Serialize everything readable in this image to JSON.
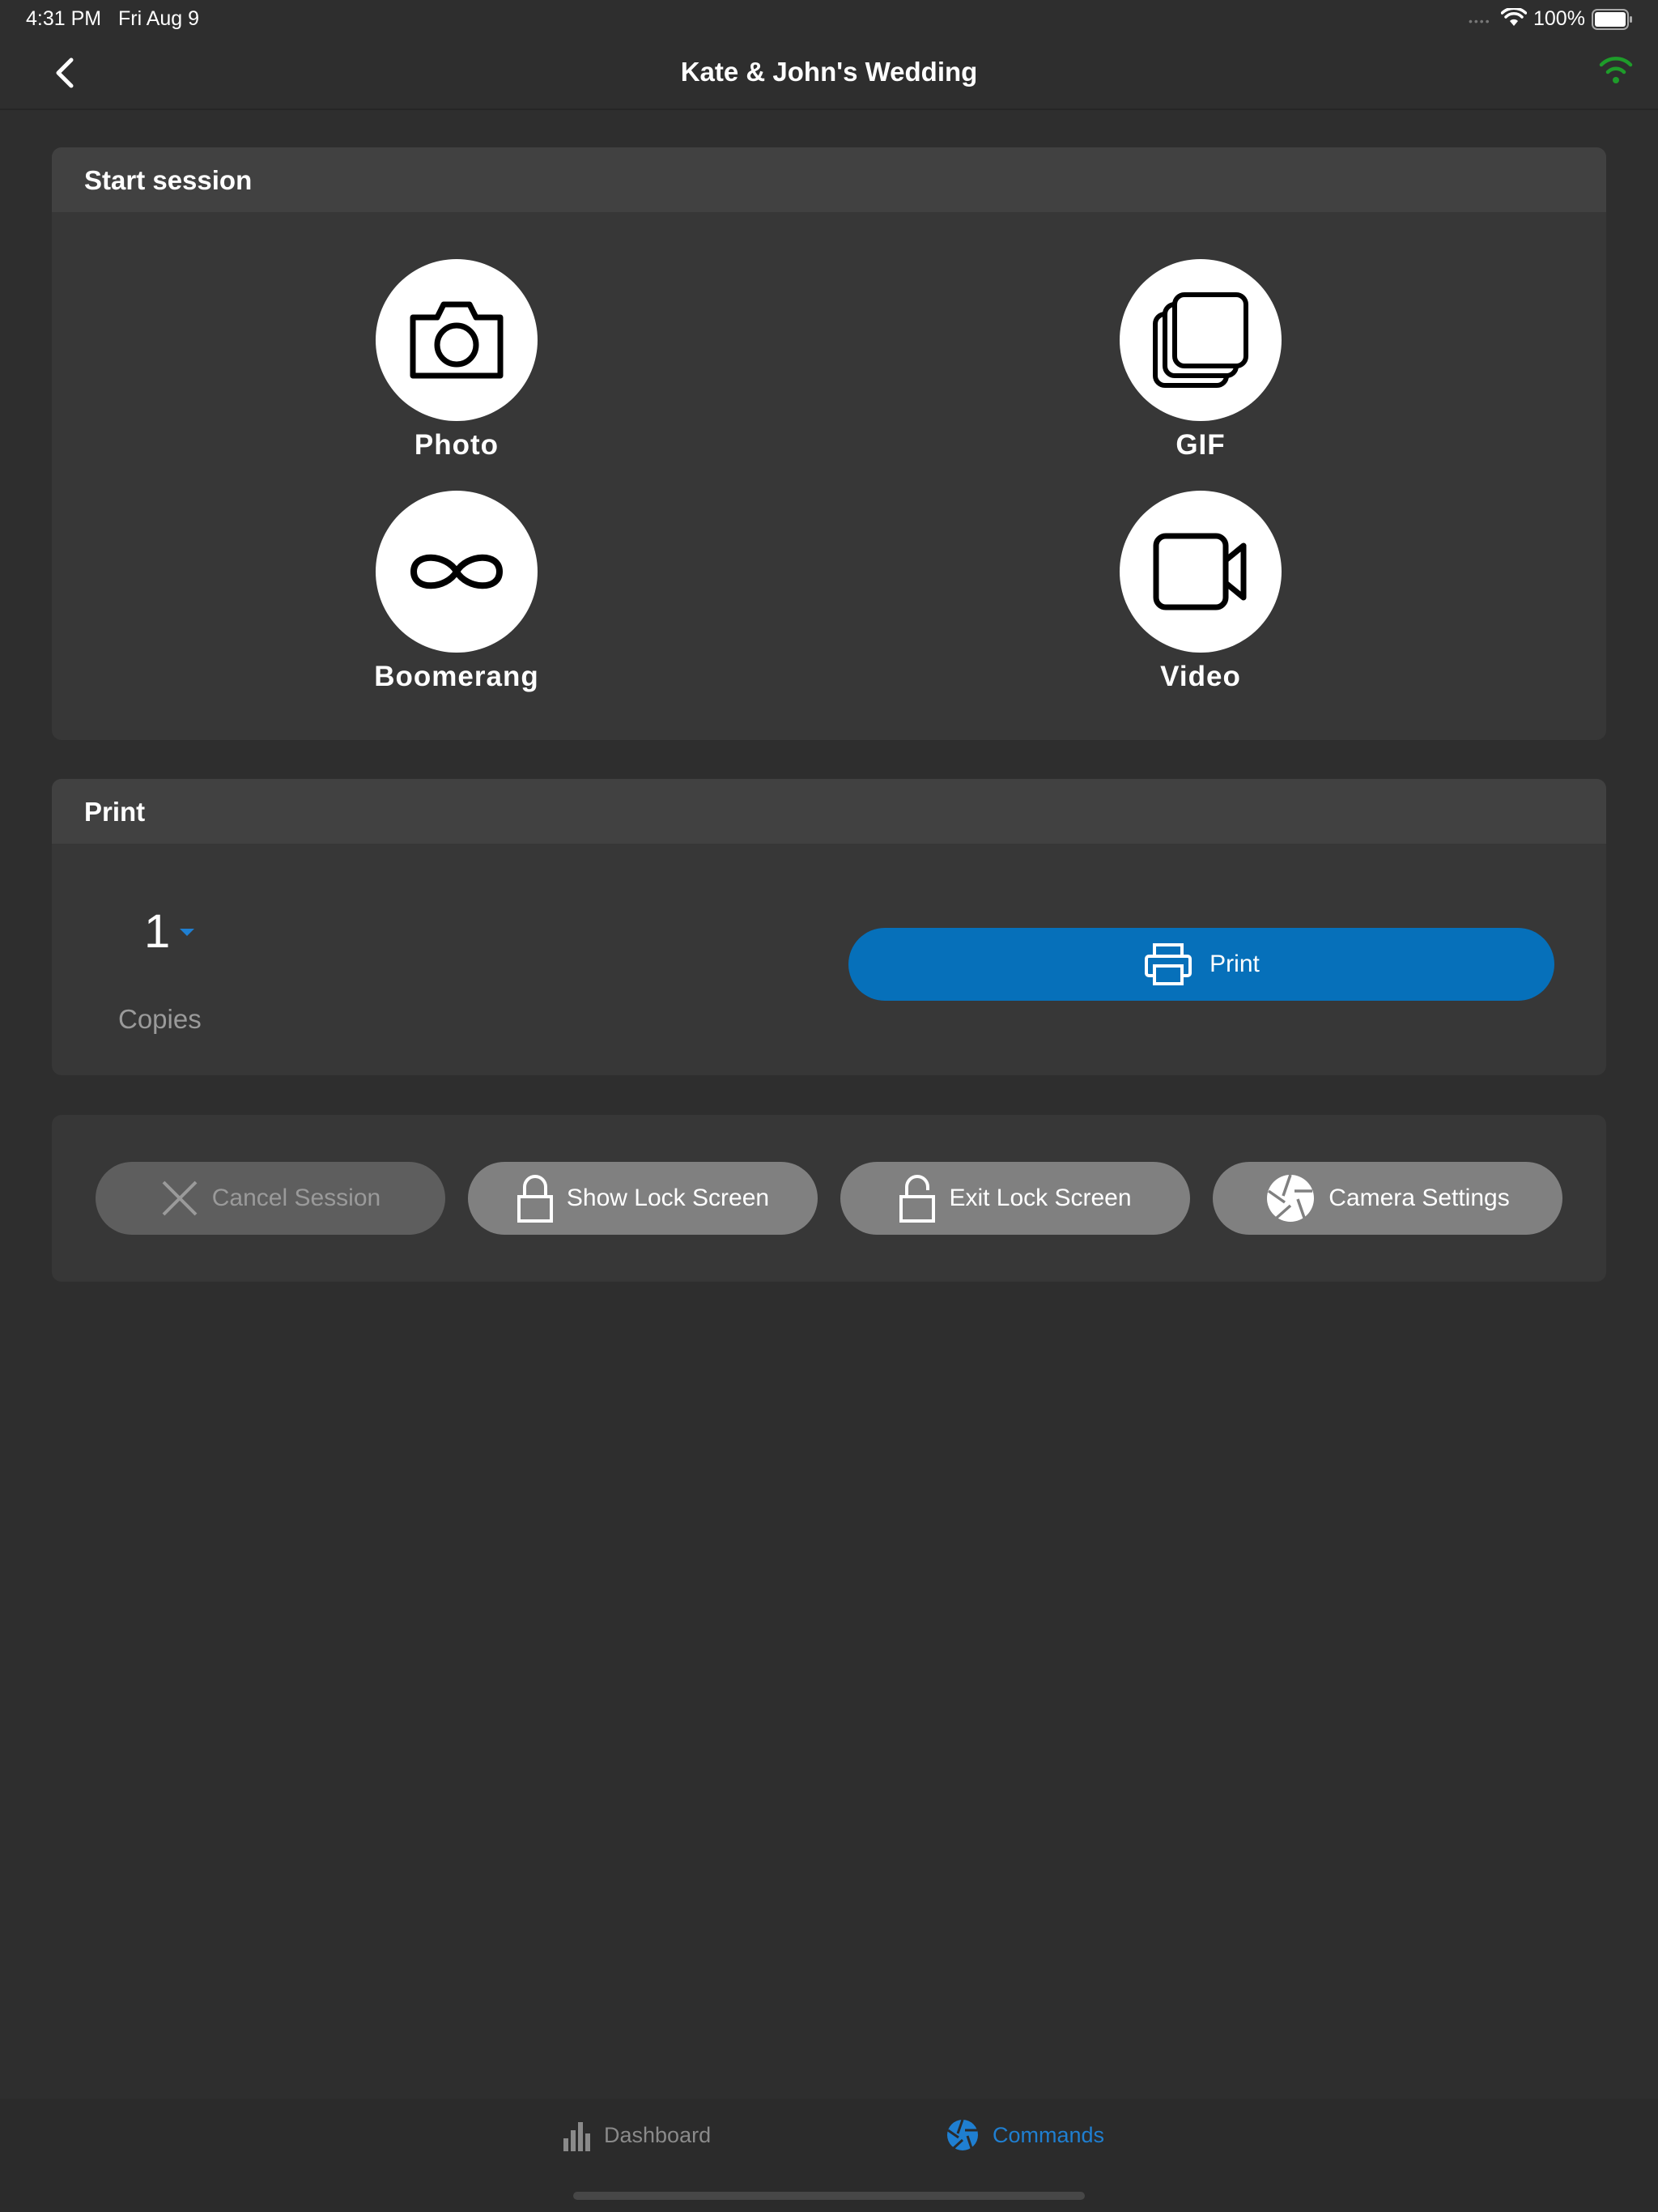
{
  "status_bar": {
    "time": "4:31 PM",
    "date": "Fri Aug 9",
    "battery": "100%"
  },
  "header": {
    "title": "Kate & John's Wedding",
    "connection_color": "#1e9c2a"
  },
  "start_session": {
    "title": "Start session",
    "modes": [
      {
        "label": "Photo",
        "icon": "camera-icon"
      },
      {
        "label": "GIF",
        "icon": "stacked-frames-icon"
      },
      {
        "label": "Boomerang",
        "icon": "infinity-icon"
      },
      {
        "label": "Video",
        "icon": "video-camera-icon"
      }
    ]
  },
  "print": {
    "title": "Print",
    "copies_value": "1",
    "copies_label": "Copies",
    "button_label": "Print",
    "accent": "#0670ba"
  },
  "actions": [
    {
      "label": "Cancel Session",
      "icon": "close-icon",
      "enabled": false
    },
    {
      "label": "Show Lock Screen",
      "icon": "lock-icon",
      "enabled": true
    },
    {
      "label": "Exit Lock Screen",
      "icon": "unlock-icon",
      "enabled": true
    },
    {
      "label": "Camera Settings",
      "icon": "aperture-icon",
      "enabled": true
    }
  ],
  "tabbar": {
    "tabs": [
      {
        "label": "Dashboard",
        "icon": "bar-chart-icon",
        "active": false
      },
      {
        "label": "Commands",
        "icon": "aperture-icon",
        "active": true
      }
    ]
  }
}
